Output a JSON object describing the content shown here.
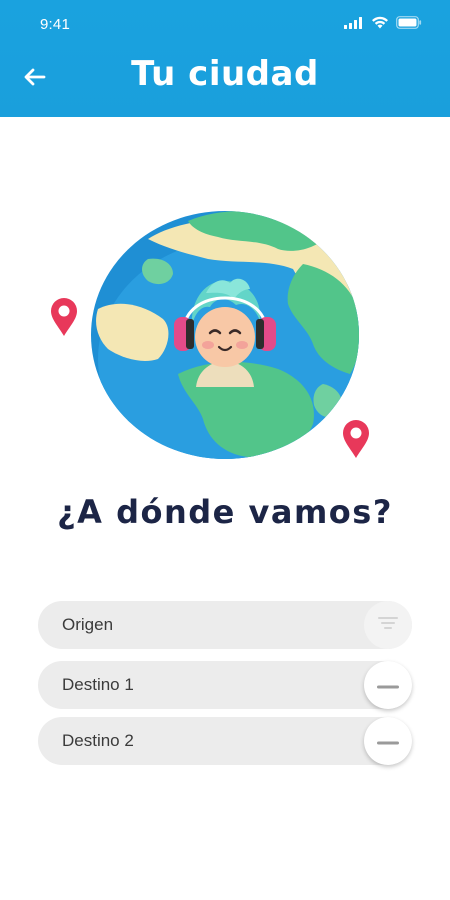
{
  "status_bar": {
    "time": "9:41",
    "icons": [
      "signal-icon",
      "wifi-icon",
      "battery-icon"
    ]
  },
  "header": {
    "title": "Tu ciudad",
    "back_icon": "arrow-left-icon",
    "background_color": "#1aa2df"
  },
  "hero": {
    "illustration": "globe-with-person-headphones",
    "pin_color": "#e8385a",
    "question": "¿A dónde vamos?"
  },
  "form": {
    "fields": [
      {
        "label": "Origen",
        "action_icon": "filter-icon"
      },
      {
        "label": "Destino 1",
        "action_icon": "minus-icon"
      },
      {
        "label": "Destino 2",
        "action_icon": "minus-icon"
      }
    ]
  }
}
